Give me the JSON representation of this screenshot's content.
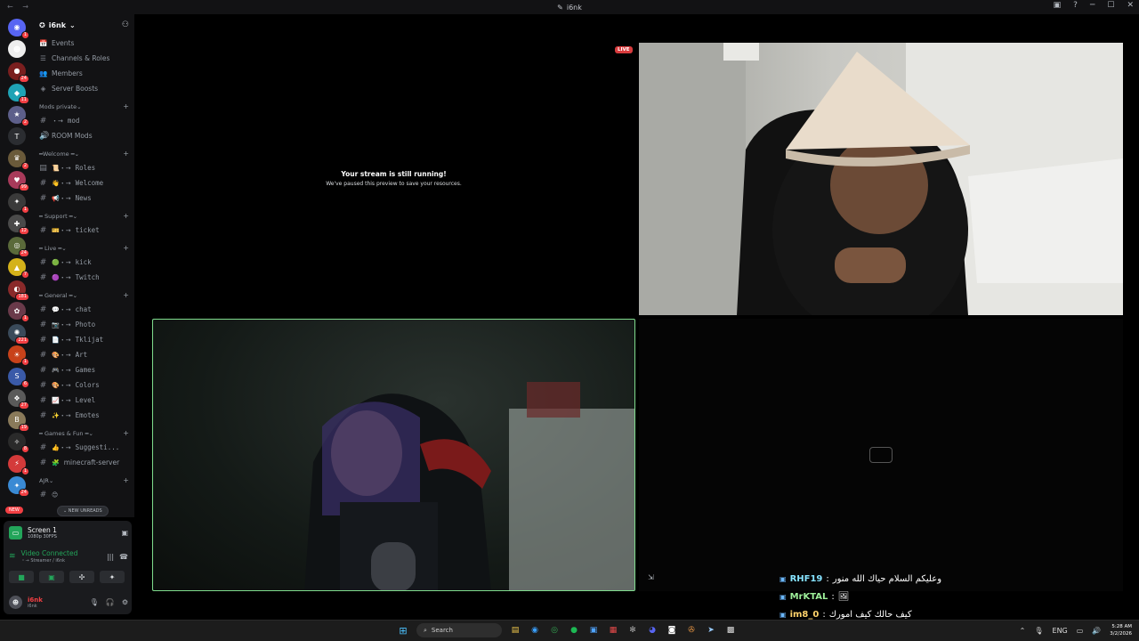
{
  "window": {
    "title": "i6nk",
    "nav": "← →"
  },
  "server": {
    "name": "i6nk"
  },
  "sidebar_items": [
    {
      "icon": "calendar-icon",
      "glyph": "📅",
      "label": "Events"
    },
    {
      "icon": "list-icon",
      "glyph": "☰",
      "label": "Channels & Roles"
    },
    {
      "icon": "members-icon",
      "glyph": "👥",
      "label": "Members"
    },
    {
      "icon": "boost-icon",
      "glyph": "◈",
      "label": "Server Boosts"
    }
  ],
  "categories": [
    {
      "name": "Mods private",
      "channels": [
        {
          "prefix": "・→",
          "name": "mod",
          "kind": "text"
        },
        {
          "prefix": "",
          "name": "ROOM Mods",
          "kind": "voice"
        }
      ]
    },
    {
      "name": "━Welcome ━",
      "channels": [
        {
          "prefix": "📜・→",
          "name": "Roles",
          "kind": "rules"
        },
        {
          "prefix": "👋・→",
          "name": "Welcome",
          "kind": "text"
        },
        {
          "prefix": "📢・→",
          "name": "News",
          "kind": "text"
        }
      ]
    },
    {
      "name": "━ Support ━",
      "channels": [
        {
          "prefix": "🎫・→",
          "name": "ticket",
          "kind": "text"
        }
      ]
    },
    {
      "name": "━ Live ━",
      "channels": [
        {
          "prefix": "🟢・→",
          "name": "kick",
          "kind": "text"
        },
        {
          "prefix": "🟣・→",
          "name": "Twitch",
          "kind": "text"
        }
      ]
    },
    {
      "name": "━ General ━",
      "channels": [
        {
          "prefix": "💬・→",
          "name": "chat",
          "kind": "text"
        },
        {
          "prefix": "📷・→",
          "name": "Photo",
          "kind": "text"
        },
        {
          "prefix": "📄・→",
          "name": "Tklijat",
          "kind": "text"
        },
        {
          "prefix": "🎨・→",
          "name": "Art",
          "kind": "text"
        },
        {
          "prefix": "🎮・→",
          "name": "Games",
          "kind": "text"
        },
        {
          "prefix": "🎨・→",
          "name": "Colors",
          "kind": "text"
        },
        {
          "prefix": "📈・→",
          "name": "Level",
          "kind": "text"
        },
        {
          "prefix": "✨・→",
          "name": "Emotes",
          "kind": "text"
        }
      ]
    },
    {
      "name": "━ Games & Fun ━",
      "channels": [
        {
          "prefix": "👍・→",
          "name": "Suggesti...",
          "kind": "text"
        },
        {
          "prefix": "🧩",
          "name": "minecraft-server",
          "kind": "text"
        }
      ]
    },
    {
      "name": "AJR",
      "channels": [
        {
          "prefix": "😊",
          "name": "",
          "kind": "text"
        }
      ]
    }
  ],
  "rail_servers": [
    {
      "t": "◉",
      "bg": "#5865f2",
      "b": "1"
    },
    {
      "t": "☻",
      "bg": "#eeeeee",
      "b": ""
    },
    {
      "t": "●",
      "bg": "#7a1f1f",
      "b": "24"
    },
    {
      "t": "◆",
      "bg": "#1fa3b5",
      "b": "11"
    },
    {
      "t": "★",
      "bg": "#5d5f8a",
      "b": "2"
    },
    {
      "t": "T",
      "bg": "#2b2d31",
      "b": ""
    },
    {
      "t": "♛",
      "bg": "#6a5a3a",
      "b": "2"
    },
    {
      "t": "♥",
      "bg": "#a83a5a",
      "b": "99"
    },
    {
      "t": "✦",
      "bg": "#3a3a3a",
      "b": "1"
    },
    {
      "t": "✚",
      "bg": "#4a4a4a",
      "b": "12"
    },
    {
      "t": "◎",
      "bg": "#5a6a3a",
      "b": "24"
    },
    {
      "t": "▲",
      "bg": "#d4b21a",
      "b": "7"
    },
    {
      "t": "◐",
      "bg": "#8a2a2a",
      "b": "181"
    },
    {
      "t": "✿",
      "bg": "#6a3a4a",
      "b": "1"
    },
    {
      "t": "✺",
      "bg": "#3a4a5a",
      "b": "221"
    },
    {
      "t": "☀",
      "bg": "#c8421a",
      "b": "1"
    },
    {
      "t": "S",
      "bg": "#3a5aa8",
      "b": "6"
    },
    {
      "t": "❖",
      "bg": "#5a5a5a",
      "b": "27"
    },
    {
      "t": "B",
      "bg": "#8a7a5a",
      "b": "19"
    },
    {
      "t": "✧",
      "bg": "#2a2a2a",
      "b": "8"
    },
    {
      "t": "⚡",
      "bg": "#d43a3a",
      "b": "1"
    },
    {
      "t": "✦",
      "bg": "#3a8ad4",
      "b": "24"
    }
  ],
  "new_badge": "NEW",
  "new_unreads": "NEW UNREADS",
  "voice": {
    "screen_name": "Screen 1",
    "screen_sub": "1080p 30FPS",
    "conn_title": "Video Connected",
    "conn_sub": "・→ Streamer / i6nk"
  },
  "user": {
    "name": "i6nk",
    "status": "i6nk"
  },
  "stage": {
    "paused_title": "Your stream is still running!",
    "paused_sub": "We've paused this preview to save your resources.",
    "live": "LIVE"
  },
  "chat": [
    {
      "name": "RHF19",
      "message": "وعليكم السلام حياك الله منور",
      "color": "#86e3ff"
    },
    {
      "name": "MrKTAL",
      "message": "🖼",
      "color": "#9ef09a"
    },
    {
      "name": "im8_0",
      "message": "كيف حالك كيف امورك",
      "color": "#ffd36b"
    }
  ],
  "taskbar": {
    "search": "Search",
    "time": "5:28 AM",
    "date": "3/2/2026",
    "lang": "ENG"
  },
  "colors": {
    "accent_green": "#23a55a",
    "danger": "#f23f43",
    "blurple": "#5865f2"
  }
}
